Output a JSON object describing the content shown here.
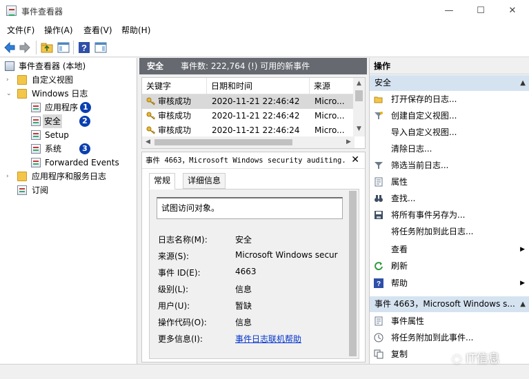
{
  "window": {
    "title": "事件查看器",
    "minimize": "—",
    "maximize": "☐",
    "close": "✕"
  },
  "menu": [
    "文件(F)",
    "操作(A)",
    "查看(V)",
    "帮助(H)"
  ],
  "tree": {
    "root": "事件查看器 (本地)",
    "custom_views": "自定义视图",
    "windows_logs": "Windows 日志",
    "logs": [
      "应用程序",
      "安全",
      "Setup",
      "系统",
      "Forwarded Events"
    ],
    "app_service_logs": "应用程序和服务日志",
    "subscriptions": "订阅",
    "badges": [
      "1",
      "2",
      "3"
    ]
  },
  "middle": {
    "header_title": "安全",
    "header_count": "事件数: 222,764 (!) 可用的新事件",
    "columns": [
      "关键字",
      "日期和时间",
      "来源"
    ],
    "rows": [
      {
        "keyword": "审核成功",
        "datetime": "2020-11-21 22:46:42",
        "source": "Micro..."
      },
      {
        "keyword": "审核成功",
        "datetime": "2020-11-21 22:46:42",
        "source": "Micro..."
      },
      {
        "keyword": "审核成功",
        "datetime": "2020-11-21 22:46:24",
        "source": "Micro..."
      }
    ]
  },
  "detail": {
    "title": "事件 4663，Microsoft Windows security auditing.",
    "close": "✕",
    "tabs": [
      "常规",
      "详细信息"
    ],
    "description": "试图访问对象。",
    "props": [
      {
        "label": "日志名称(M):",
        "value": "安全"
      },
      {
        "label": "来源(S):",
        "value": "Microsoft Windows secur"
      },
      {
        "label": "事件 ID(E):",
        "value": "4663"
      },
      {
        "label": "级别(L):",
        "value": "信息"
      },
      {
        "label": "用户(U):",
        "value": "暂缺"
      },
      {
        "label": "操作代码(O):",
        "value": "信息"
      },
      {
        "label": "更多信息(I):",
        "value": "事件日志联机帮助"
      }
    ]
  },
  "actions": {
    "header": "操作",
    "section1": "安全",
    "items1": [
      "打开保存的日志...",
      "创建自定义视图...",
      "导入自定义视图...",
      "清除日志...",
      "筛选当前日志...",
      "属性",
      "查找...",
      "将所有事件另存为...",
      "将任务附加到此日志...",
      "查看",
      "刷新",
      "帮助"
    ],
    "section2": "事件 4663，Microsoft Windows s...",
    "items2": [
      "事件属性",
      "将任务附加到此事件...",
      "复制"
    ]
  },
  "watermark": "IT信息",
  "colors": {
    "badge": "#0b3fb0",
    "section": "#d5e3f1",
    "header": "#666a70"
  }
}
